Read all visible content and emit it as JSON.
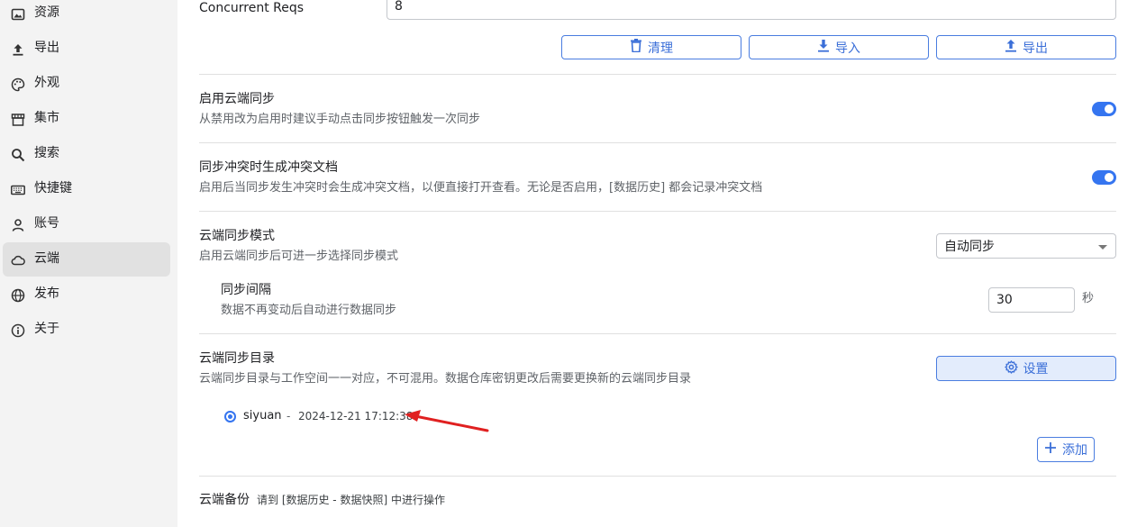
{
  "sidebar": {
    "items": [
      {
        "label": "资源",
        "icon": "image-icon"
      },
      {
        "label": "导出",
        "icon": "upload-icon"
      },
      {
        "label": "外观",
        "icon": "palette-icon"
      },
      {
        "label": "集市",
        "icon": "store-icon"
      },
      {
        "label": "搜索",
        "icon": "search-icon"
      },
      {
        "label": "快捷键",
        "icon": "keyboard-icon"
      },
      {
        "label": "账号",
        "icon": "user-icon"
      },
      {
        "label": "云端",
        "icon": "cloud-icon"
      },
      {
        "label": "发布",
        "icon": "globe-icon"
      },
      {
        "label": "关于",
        "icon": "info-icon"
      }
    ],
    "active": "云端"
  },
  "concurrent": {
    "label": "Concurrent Reqs",
    "value": "8"
  },
  "actions": {
    "clean_label": "清理",
    "import_label": "导入",
    "export_label": "导出"
  },
  "cloud_sync": {
    "title": "启用云端同步",
    "desc": "从禁用改为启用时建议手动点击同步按钮触发一次同步",
    "enabled": true
  },
  "conflict": {
    "title": "同步冲突时生成冲突文档",
    "desc": "启用后当同步发生冲突时会生成冲突文档，以便直接打开查看。无论是否启用，[数据历史] 都会记录冲突文档",
    "enabled": true
  },
  "sync_mode": {
    "title": "云端同步模式",
    "desc": "启用云端同步后可进一步选择同步模式",
    "selected": "自动同步"
  },
  "interval": {
    "title": "同步间隔",
    "desc": "数据不再变动后自动进行数据同步",
    "value": "30",
    "unit": "秒"
  },
  "sync_dir": {
    "title": "云端同步目录",
    "desc": "云端同步目录与工作空间一一对应，不可混用。数据仓库密钥更改后需要更换新的云端同步目录",
    "settings_label": "设置",
    "entry": {
      "name": "siyuan",
      "separator": "-",
      "timestamp": "2024-12-21 17:12:38"
    },
    "add_label": "添加"
  },
  "backup": {
    "title": "云端备份",
    "hint": "请到 [数据历史 - 数据快照] 中进行操作"
  },
  "colors": {
    "accent": "#3575f0",
    "annotation_arrow": "#e02020"
  }
}
